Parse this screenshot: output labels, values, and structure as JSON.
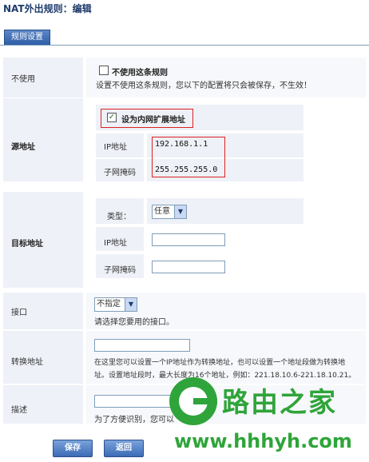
{
  "title": "NAT外出规则：编辑",
  "tab": "规则设置",
  "unused": {
    "label": "不使用",
    "checkbox_label": "不使用这条规则",
    "hint": "设置不使用这条规则，您以下的配置将只会被保存，不生效！"
  },
  "source": {
    "label": "源地址",
    "extend_label": "设为内网扩展地址",
    "ip_label": "IP地址",
    "ip_value": "192.168.1.1",
    "mask_label": "子网掩码",
    "mask_value": "255.255.255.0"
  },
  "dest": {
    "label": "目标地址",
    "type_label": "类型：",
    "type_value": "任意",
    "ip_label": "IP地址",
    "mask_label": "子网掩码"
  },
  "iface": {
    "label": "接口",
    "value": "不指定",
    "hint": "请选择您要用的接口。"
  },
  "convert": {
    "label": "转换地址",
    "hint1": "在这里您可以设置一个IP地址作为转换地址，也可以设置一个地址段做为转换地",
    "hint2": "址。设置地址段时，最大长度为16个地址，例如：221.18.10.6-221.18.10.21。"
  },
  "desc": {
    "label": "描述",
    "hint": "为了方便识别，您可以"
  },
  "buttons": {
    "save": "保存",
    "back": "返回"
  },
  "watermark": {
    "brand": "路由之家",
    "url": "www.hhhyh.com"
  },
  "icons": {
    "checked": "check-icon",
    "dropdown": "chevron-down-icon"
  },
  "colors": {
    "accent": "#2d5ea8",
    "highlight": "#dd2222",
    "watermark": "#2fa43a"
  }
}
